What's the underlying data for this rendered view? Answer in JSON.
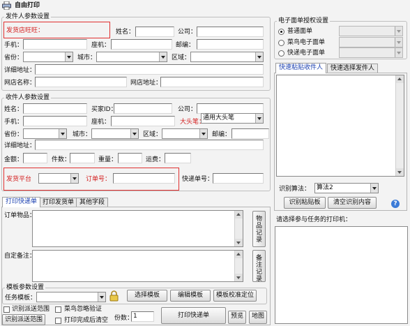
{
  "window": {
    "title": "自由打印"
  },
  "sender": {
    "group_title": "发件人参数设置",
    "shop_wangwang": "发货店旺旺：",
    "name": "姓名：",
    "company": "公司：",
    "mobile": "手机：",
    "landline": "座机：",
    "postcode": "邮编：",
    "province": "省份：",
    "city": "城市：",
    "district": "区域：",
    "address": "详细地址：",
    "shop_name": "网店名称：",
    "shop_url": "网店地址："
  },
  "receiver": {
    "group_title": "收件人参数设置",
    "name": "姓名：",
    "buyer_id": "买家ID：",
    "company": "公司：",
    "mobile": "手机：",
    "landline": "座机：",
    "big_head_pen": "大头笔：",
    "big_head_value": "通用大头笔",
    "province": "省份：",
    "city": "城市：",
    "district": "区域：",
    "postcode": "邮编：",
    "address": "详细地址：",
    "amount": "金额：",
    "pieces": "件数：",
    "weight": "重量：",
    "freight": "运费："
  },
  "shipping": {
    "platform": "发货平台",
    "order_no": "订单号：",
    "express_no": "快递单号："
  },
  "bottom_tabs": [
    "打印快递单",
    "打印发货单",
    "其他字段"
  ],
  "order_items": {
    "label": "订单物品：",
    "side_button": "物品记录"
  },
  "custom_note": {
    "label": "自定备注：",
    "side_button": "备注记录"
  },
  "template": {
    "group_title": "模板参数设置",
    "task_template": "任务模板：",
    "select_btn": "选择模板",
    "edit_btn": "编辑模板",
    "calibrate_btn": "模板校准定位"
  },
  "footer": {
    "identify_range": "识别派送范围",
    "cainiao_skip": "菜鸟忽略验证",
    "identify_range_btn": "识别派送范围",
    "clear_after_print": "打印完成后清空",
    "copies_label": "份数：",
    "copies_value": "1",
    "print_btn": "打印快递单",
    "preview_btn": "预览",
    "map_btn": "地图"
  },
  "eface": {
    "group_title": "电子面单授权设置",
    "options": [
      "普通面单",
      "菜鸟电子面单",
      "快递电子面单"
    ],
    "selected_index": 0
  },
  "right_tabs": [
    "快速粘贴收件人",
    "快速选择发件人"
  ],
  "recognition": {
    "algo_label": "识别算法：",
    "algo_value": "算法2",
    "paste_btn": "识别粘贴板",
    "clear_btn": "清空识别内容"
  },
  "printers": {
    "label": "请选择参与任务的打印机："
  },
  "colors": {
    "accent_blue": "#1a3fb0",
    "warning_red": "#d42020"
  }
}
